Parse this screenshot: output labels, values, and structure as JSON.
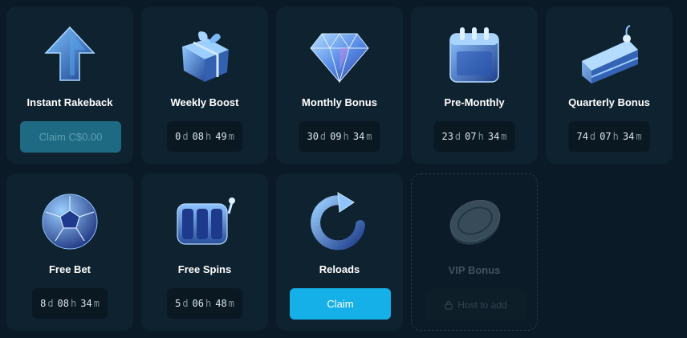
{
  "cards": {
    "instant_rakeback": {
      "title": "Instant Rakeback",
      "button": "Claim C$0.00",
      "icon": "arrow-up-icon"
    },
    "weekly_boost": {
      "title": "Weekly Boost",
      "icon": "gift-box-icon",
      "timer": {
        "d": "0",
        "h": "08",
        "m": "49"
      }
    },
    "monthly_bonus": {
      "title": "Monthly Bonus",
      "icon": "diamond-icon",
      "timer": {
        "d": "30",
        "h": "09",
        "m": "34"
      }
    },
    "pre_monthly": {
      "title": "Pre-Monthly",
      "icon": "calendar-icon",
      "timer": {
        "d": "23",
        "h": "07",
        "m": "34"
      }
    },
    "quarterly_bonus": {
      "title": "Quarterly Bonus",
      "icon": "cake-slice-icon",
      "timer": {
        "d": "74",
        "h": "07",
        "m": "34"
      }
    },
    "free_bet": {
      "title": "Free Bet",
      "icon": "soccer-ball-icon",
      "timer": {
        "d": "8",
        "h": "08",
        "m": "34"
      }
    },
    "free_spins": {
      "title": "Free Spins",
      "icon": "slot-reels-icon",
      "timer": {
        "d": "5",
        "h": "06",
        "m": "48"
      }
    },
    "reloads": {
      "title": "Reloads",
      "button": "Claim",
      "icon": "reload-arrow-icon"
    },
    "vip_bonus": {
      "title": "VIP Bonus",
      "button": "Host to add",
      "icon": "coin-icon"
    }
  },
  "units": {
    "d": "d",
    "h": "h",
    "m": "m"
  },
  "colors": {
    "card_bg": "#0f2230",
    "page_bg": "#0a1a26",
    "accent": "#16b0e8",
    "accent_muted": "#1d6a82"
  }
}
